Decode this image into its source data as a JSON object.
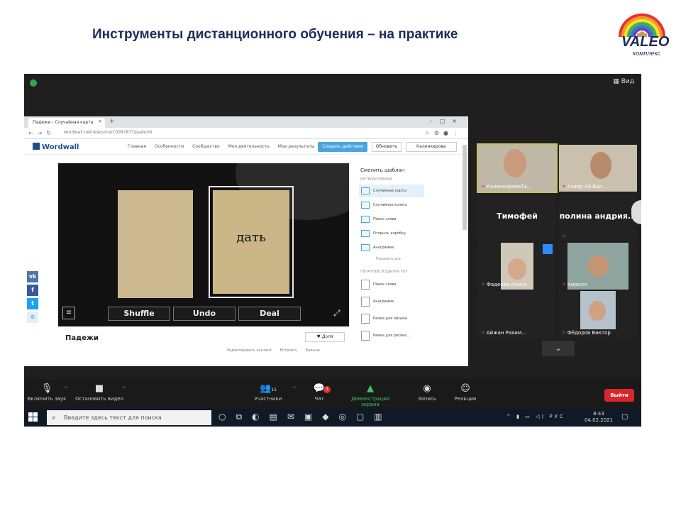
{
  "slide": {
    "title": "Инструменты дистанционного обучения – на практике",
    "logo_text": "VALEO",
    "logo_sub": "комплекс"
  },
  "browser": {
    "tab_title": "Падежи - Случайная карта",
    "url": "wordwall.net/resource/10087877/padezhi",
    "site_logo": "Wordwall",
    "nav": [
      "Главная",
      "Особенности",
      "Сообщество",
      "Моя деятельность",
      "Мои результаты"
    ],
    "create_button": "Создать действие",
    "publish_button": "Обновить",
    "user_name": "Калинкерова"
  },
  "game": {
    "card_word": "дать",
    "buttons": [
      "Shuffle",
      "Undo",
      "Deal"
    ],
    "activity_title": "Падежи",
    "like_label": "Доля",
    "edit_links": [
      "Редактировать контент",
      "Встроить",
      "Больше"
    ]
  },
  "template_panel": {
    "title": "Сменить шаблон",
    "interactive_label": "ИНТЕРАКТИВНЫЕ",
    "interactive_items": [
      "Случайные карты",
      "Случайное колесо",
      "Поиск слова",
      "Открыть коробку",
      "Анаграмма"
    ],
    "show_all": "Показать все",
    "print_label": "ПЕЧАТНЫЕ ИЗДАНИЯ",
    "print_badge": "PDF",
    "print_items": [
      "Поиск слова",
      "Анаграмма",
      "Рамка для письма",
      "Рамка для рисова..."
    ]
  },
  "participants": [
    {
      "label": "КалинкероваТа...",
      "kind": "video",
      "highlight": true
    },
    {
      "label": "Азаер Ай Вал...",
      "kind": "video",
      "highlight": false
    },
    {
      "center_name": "Тимофей",
      "label": "",
      "kind": "name"
    },
    {
      "center_name": "полина андрия...",
      "label": "",
      "kind": "name"
    },
    {
      "label": "Фадеева Алиса",
      "kind": "video"
    },
    {
      "label": "Кирилл",
      "kind": "video"
    },
    {
      "label": "Айжан Рахим...",
      "kind": "dark"
    },
    {
      "label": "Фёдоров Виктор",
      "kind": "video"
    }
  ],
  "toolbar": {
    "unmute": "Включить звук",
    "stop_video": "Остановить видео",
    "participants": "Участники",
    "participants_count": "15",
    "chat": "Чат",
    "chat_badge": "1",
    "share": "Демонстрация экрана",
    "record": "Запись",
    "reactions": "Реакции",
    "leave": "Выйти"
  },
  "taskbar": {
    "search_placeholder": "Введите здесь текст для поиска",
    "lang": "РУС",
    "time": "8:43",
    "date": "04.02.2021"
  },
  "colors": {
    "title": "#1f2a5c",
    "accent_blue": "#4aa3df",
    "zoom_green": "#3fc26b",
    "leave_red": "#d8262a"
  }
}
